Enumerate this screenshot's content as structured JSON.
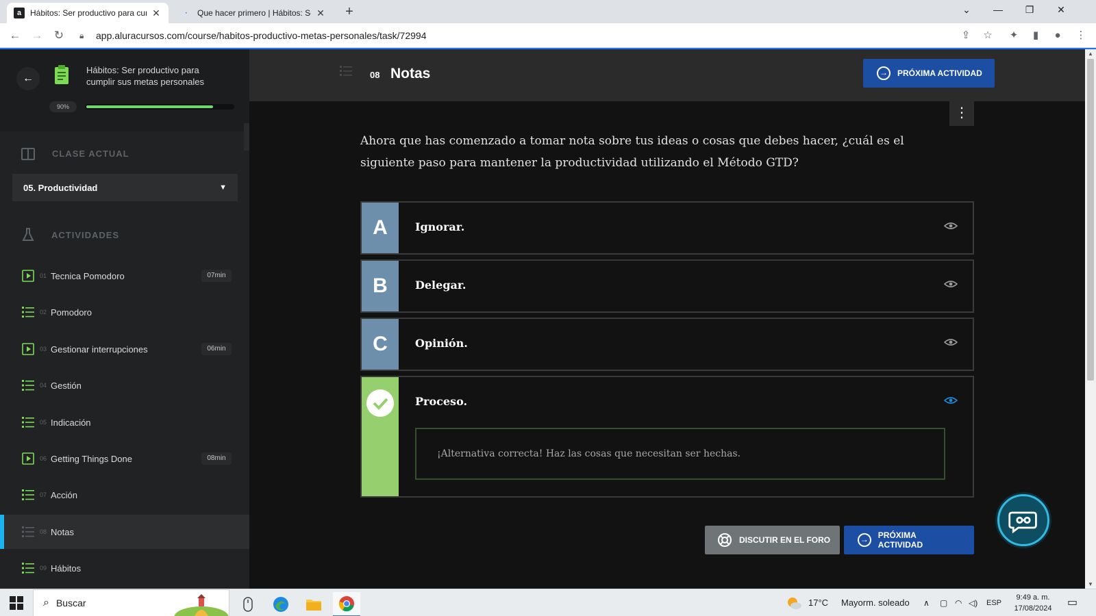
{
  "browser": {
    "tabs": [
      {
        "title": "Hábitos: Ser productivo para cumplir sus metas personales",
        "favicon": "a"
      },
      {
        "title": "Que hacer primero | Hábitos: Ser productivo",
        "favicon": "·"
      }
    ],
    "url": "app.aluracursos.com/course/habitos-productivo-metas-personales/task/72994"
  },
  "sidebar": {
    "course_title": "Hábitos: Ser productivo para cumplir sus metas personales",
    "progress_label": "90%",
    "progress_value": 0.9,
    "current_class_heading": "CLASE ACTUAL",
    "current_class": "05. Productividad",
    "activities_heading": "ACTIVIDADES",
    "activities": [
      {
        "num": "01",
        "label": "Tecnica Pomodoro",
        "duration": "07min",
        "type": "video"
      },
      {
        "num": "02",
        "label": "Pomodoro",
        "duration": "",
        "type": "list"
      },
      {
        "num": "03",
        "label": "Gestionar interrupciones",
        "duration": "06min",
        "type": "video"
      },
      {
        "num": "04",
        "label": "Gestión",
        "duration": "",
        "type": "list"
      },
      {
        "num": "05",
        "label": "Indicación",
        "duration": "",
        "type": "list"
      },
      {
        "num": "06",
        "label": "Getting Things Done",
        "duration": "08min",
        "type": "video"
      },
      {
        "num": "07",
        "label": "Acción",
        "duration": "",
        "type": "list"
      },
      {
        "num": "08",
        "label": "Notas",
        "duration": "",
        "type": "list",
        "active": true
      },
      {
        "num": "09",
        "label": "Hábitos",
        "duration": "",
        "type": "list"
      }
    ]
  },
  "main": {
    "activity_number": "08",
    "activity_title": "Notas",
    "next_label": "PRÓXIMA ACTIVIDAD",
    "question": "Ahora que has comenzado a tomar nota sobre tus ideas o cosas que debes hacer, ¿cuál es el siguiente paso para mantener la productividad utilizando el Método GTD?",
    "options": [
      {
        "letter": "A",
        "text": "Ignorar."
      },
      {
        "letter": "B",
        "text": "Delegar."
      },
      {
        "letter": "C",
        "text": "Opinión."
      },
      {
        "letter": "",
        "text": "Proceso.",
        "correct": true
      }
    ],
    "feedback": "¡Alternativa correcta! Haz las cosas que necesitan ser hechas.",
    "forum_label": "DISCUTIR EN EL FORO",
    "next_bottom_label": "PRÓXIMA ACTIVIDAD"
  },
  "taskbar": {
    "search_placeholder": "Buscar",
    "weather_temp": "17°C",
    "weather_text": "Mayorm. soleado",
    "lang": "ESP",
    "time": "9:49 a. m.",
    "date": "17/08/2024"
  },
  "colors": {
    "accent_blue": "#1c4ea4",
    "correct_green": "#96cf6e",
    "option_letter": "#6e8fab",
    "progress_green": "#6fd86f",
    "active_indicator": "#1bb1f0"
  }
}
